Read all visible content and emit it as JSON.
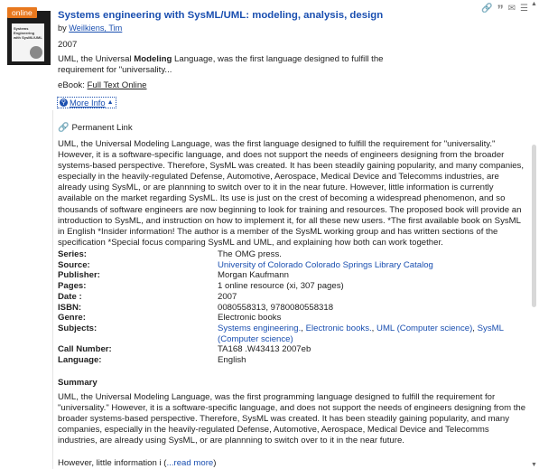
{
  "record": {
    "badge": "online",
    "cover": {
      "line1": "Systems",
      "line2": "Engineering",
      "line3": "with SysML/UML"
    },
    "title": "Systems engineering with SysML/UML: modeling, analysis, design",
    "author_prefix": "by",
    "author": "Weilkiens, Tim",
    "year": "2007",
    "snippet_before": "UML, the Universal ",
    "snippet_bold": "Modeling",
    "snippet_after": " Language, was the first language designed to fulfill the requirement for \"universality...",
    "format_label": "eBook:",
    "format_link": "Full Text Online",
    "more_info_label": "More Info",
    "permalink_label": "Permanent Link",
    "description": "UML, the Universal Modeling Language, was the first language designed to fulfill the requirement for \"universality.\" However, it is a software-specific language, and does not support the needs of engineers designing from the broader systems-based perspective. Therefore, SysML was created. It has been steadily gaining popularity, and many companies, especially in the heavily-regulated Defense, Automotive, Aerospace, Medical Device and Telecomms industries, are already using SysML, or are plannning to switch over to it in the near future. However, little information is currently available on the market regarding SysML. Its use is just on the crest of becoming a widespread phenomenon, and so thousands of software engineers are now beginning to look for training and resources. The proposed book will provide an introduction to SysML, and instruction on how to implement it, for all these new users. *The first available book on SysML in English *Insider information! The author is a member of the SysML working group and has written sections of the specification *Special focus comparing SysML and UML, and explaining how both can work together.",
    "fields": {
      "series_label": "Series:",
      "series_value": "The OMG press.",
      "source_label": "Source:",
      "source_value": "University of Colorado Colorado Springs Library Catalog",
      "publisher_label": "Publisher:",
      "publisher_value": "Morgan Kaufmann",
      "pages_label": "Pages:",
      "pages_value": "1 online resource (xi, 307 pages)",
      "date_label": "Date :",
      "date_value": "2007",
      "isbn_label": "ISBN:",
      "isbn_value": "0080558313, 9780080558318",
      "genre_label": "Genre:",
      "genre_value": "Electronic books",
      "subjects_label": "Subjects:",
      "subjects": [
        "Systems engineering.",
        "Electronic books.",
        "UML (Computer science)",
        "SysML (Computer science)"
      ],
      "callnumber_label": "Call Number:",
      "callnumber_value": "TA168 .W43413 2007eb",
      "language_label": "Language:",
      "language_value": "English"
    },
    "summary_heading": "Summary",
    "summary": "UML, the Universal Modeling Language, was the first programming language designed to fulfill the requirement for \"universality.\" However, it is a software-specific language, and does not support the needs of engineers designing from the broader systems-based perspective. Therefore, SysML was created. It has been steadily gaining popularity, and many companies, especially in the heavily-regulated Defense, Automotive, Aerospace, Medical Device and Telecomms industries, are already using SysML, or are plannning to switch over to it in the near future.",
    "summary_more_prefix": "However, little information i (",
    "summary_more_link": "...read more",
    "summary_more_suffix": ")"
  },
  "toolbar": {
    "link_icon": "🔗",
    "quote_icon": "”",
    "email_icon": "✉",
    "more_icon": "☰"
  },
  "colors": {
    "accent": "#1a4fb0",
    "badge": "#e8781e"
  }
}
